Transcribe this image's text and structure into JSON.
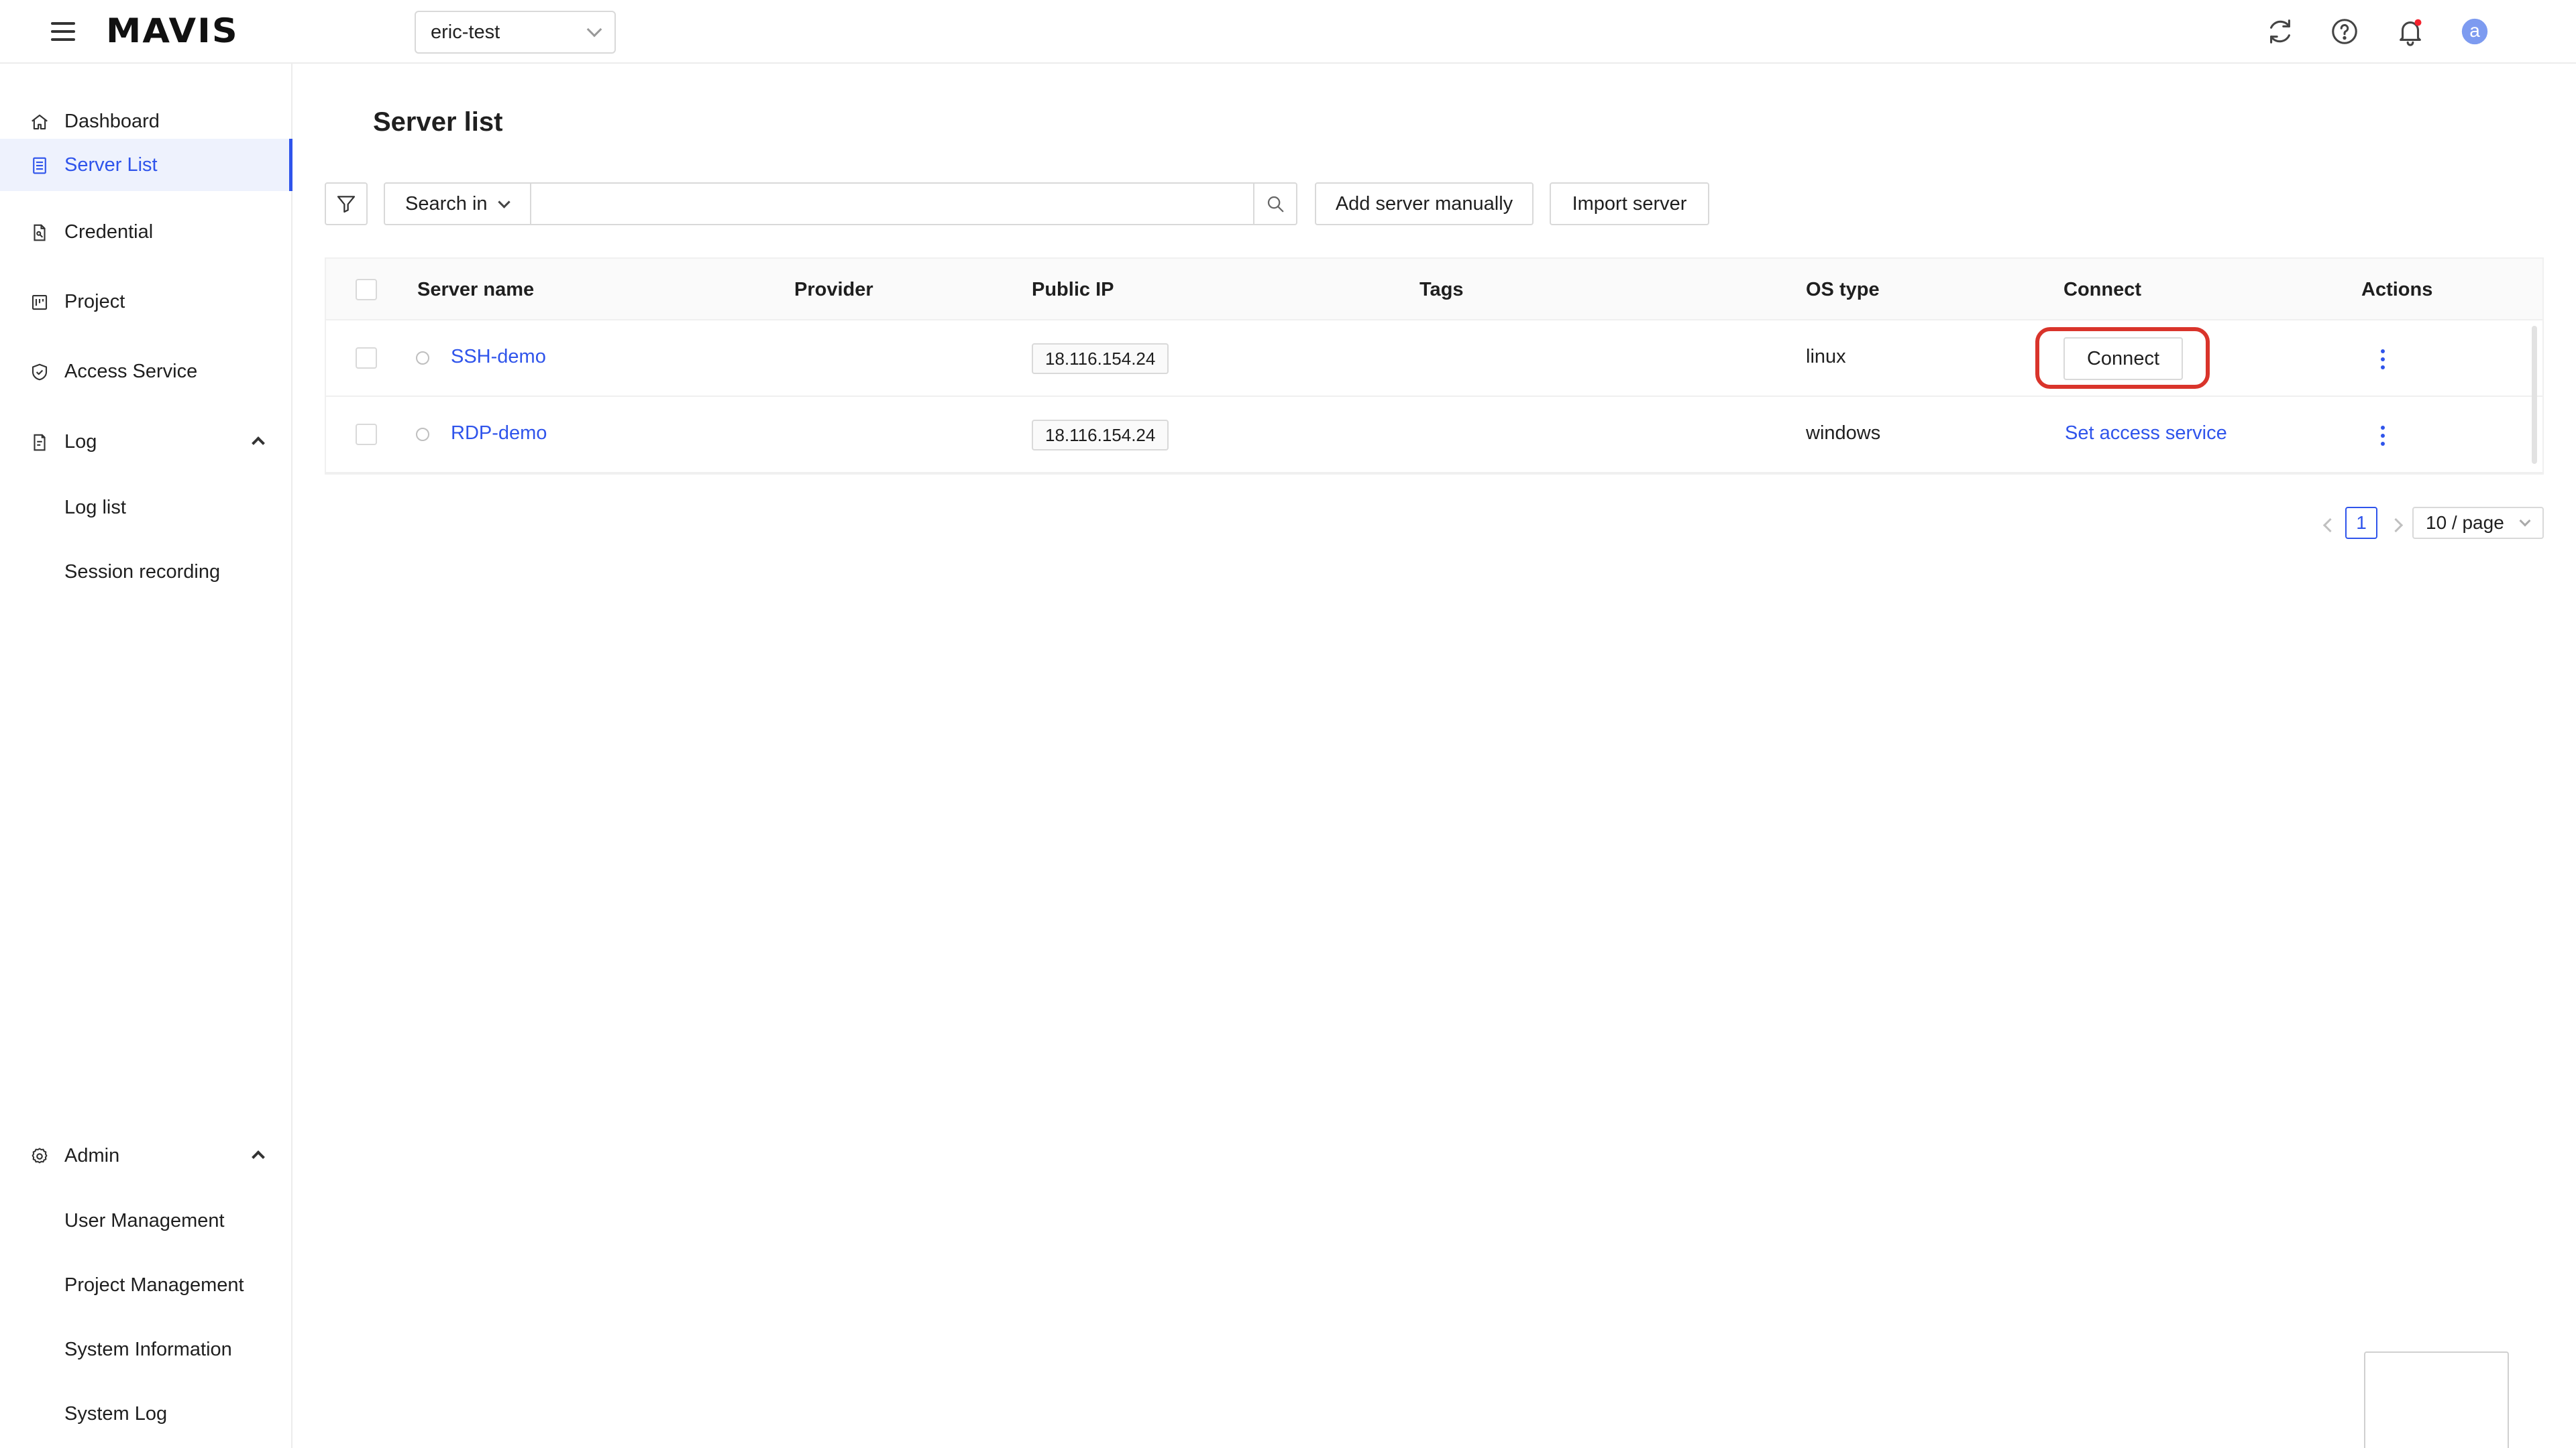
{
  "header": {
    "logo": "MAVIS",
    "project_select": {
      "value": "eric-test"
    }
  },
  "sidebar": {
    "items": [
      {
        "label": "Dashboard",
        "icon": "home-icon"
      },
      {
        "label": "Server List",
        "icon": "server-list-icon",
        "active": true
      },
      {
        "label": "Credential",
        "icon": "credential-icon"
      },
      {
        "label": "Project",
        "icon": "project-icon"
      },
      {
        "label": "Access Service",
        "icon": "shield-check-icon"
      },
      {
        "label": "Log",
        "icon": "log-icon",
        "expanded": true
      }
    ],
    "log_sub": [
      "Log list",
      "Session recording"
    ],
    "admin": {
      "label": "Admin",
      "icon": "gear-icon",
      "expanded": true
    },
    "admin_sub": [
      "User Management",
      "Project Management",
      "System Information",
      "System Log"
    ]
  },
  "main": {
    "title": "Server list",
    "toolbar": {
      "search_in_label": "Search in",
      "search_placeholder": "",
      "add_server_label": "Add server manually",
      "import_server_label": "Import server"
    },
    "table": {
      "columns": [
        "Server name",
        "Provider",
        "Public IP",
        "Tags",
        "OS type",
        "Connect",
        "Actions"
      ],
      "rows": [
        {
          "name": "SSH-demo",
          "provider": "",
          "ip": "18.116.154.24",
          "tags": "",
          "os": "linux",
          "connect": "Connect",
          "connect_type": "button"
        },
        {
          "name": "RDP-demo",
          "provider": "",
          "ip": "18.116.154.24",
          "tags": "",
          "os": "windows",
          "connect": "Set access service",
          "connect_type": "link"
        }
      ]
    },
    "pagination": {
      "current": "1",
      "page_size": "10 / page"
    }
  },
  "colors": {
    "accent": "#2f54eb",
    "highlight": "#d9342b",
    "notification_dot": "#f5222d",
    "avatar": "#7d9bf0"
  },
  "avatar_letter": "a"
}
